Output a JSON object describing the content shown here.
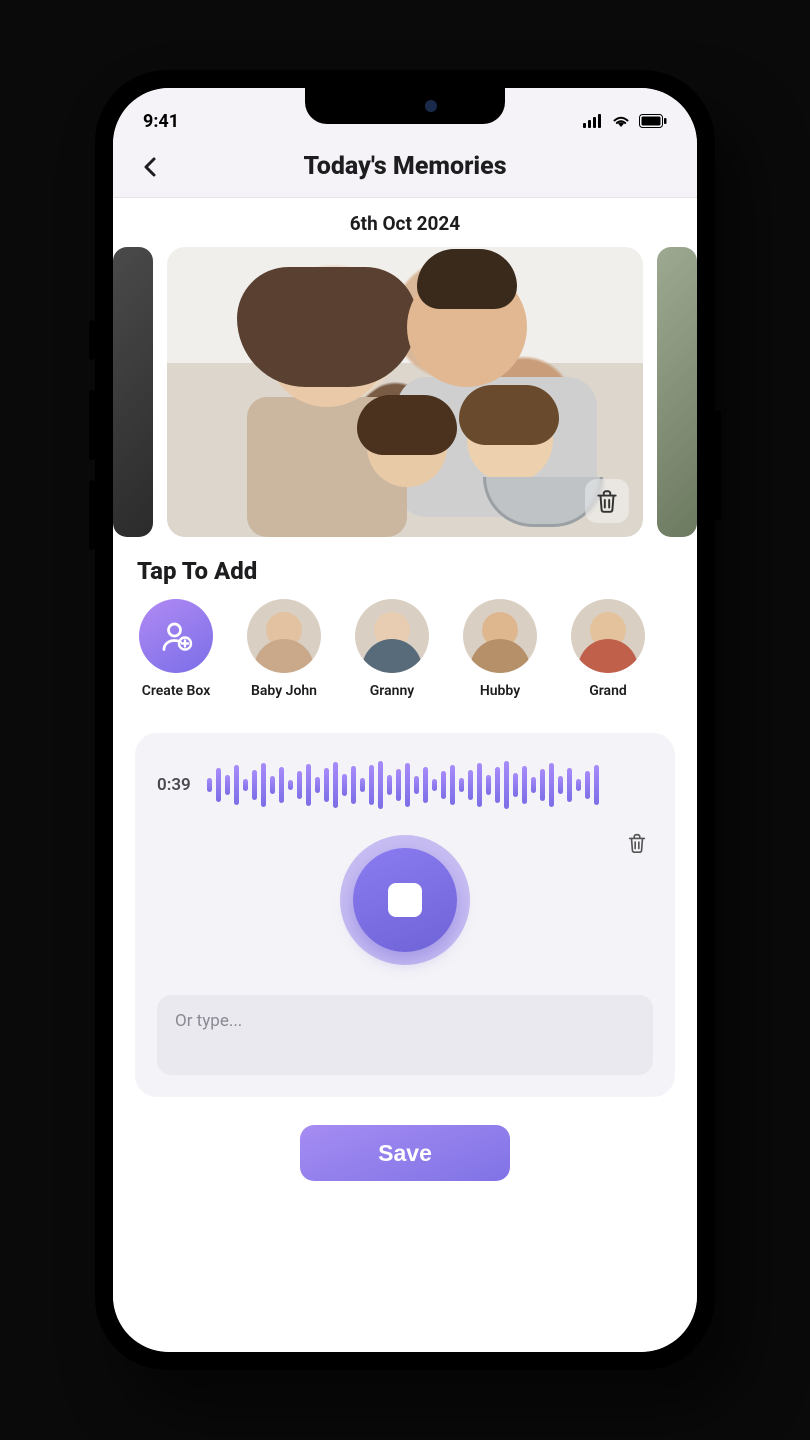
{
  "status": {
    "time": "9:41"
  },
  "header": {
    "title": "Today's Memories"
  },
  "date": "6th Oct 2024",
  "section_title": "Tap To Add",
  "boxes": {
    "create_label": "Create Box",
    "items": [
      {
        "label": "Baby John"
      },
      {
        "label": "Granny"
      },
      {
        "label": "Hubby"
      },
      {
        "label": "Grand"
      }
    ]
  },
  "recorder": {
    "time": "0:39",
    "placeholder": "Or type..."
  },
  "save_label": "Save",
  "colors": {
    "accent_from": "#a58cf2",
    "accent_to": "#7c6ee6"
  }
}
